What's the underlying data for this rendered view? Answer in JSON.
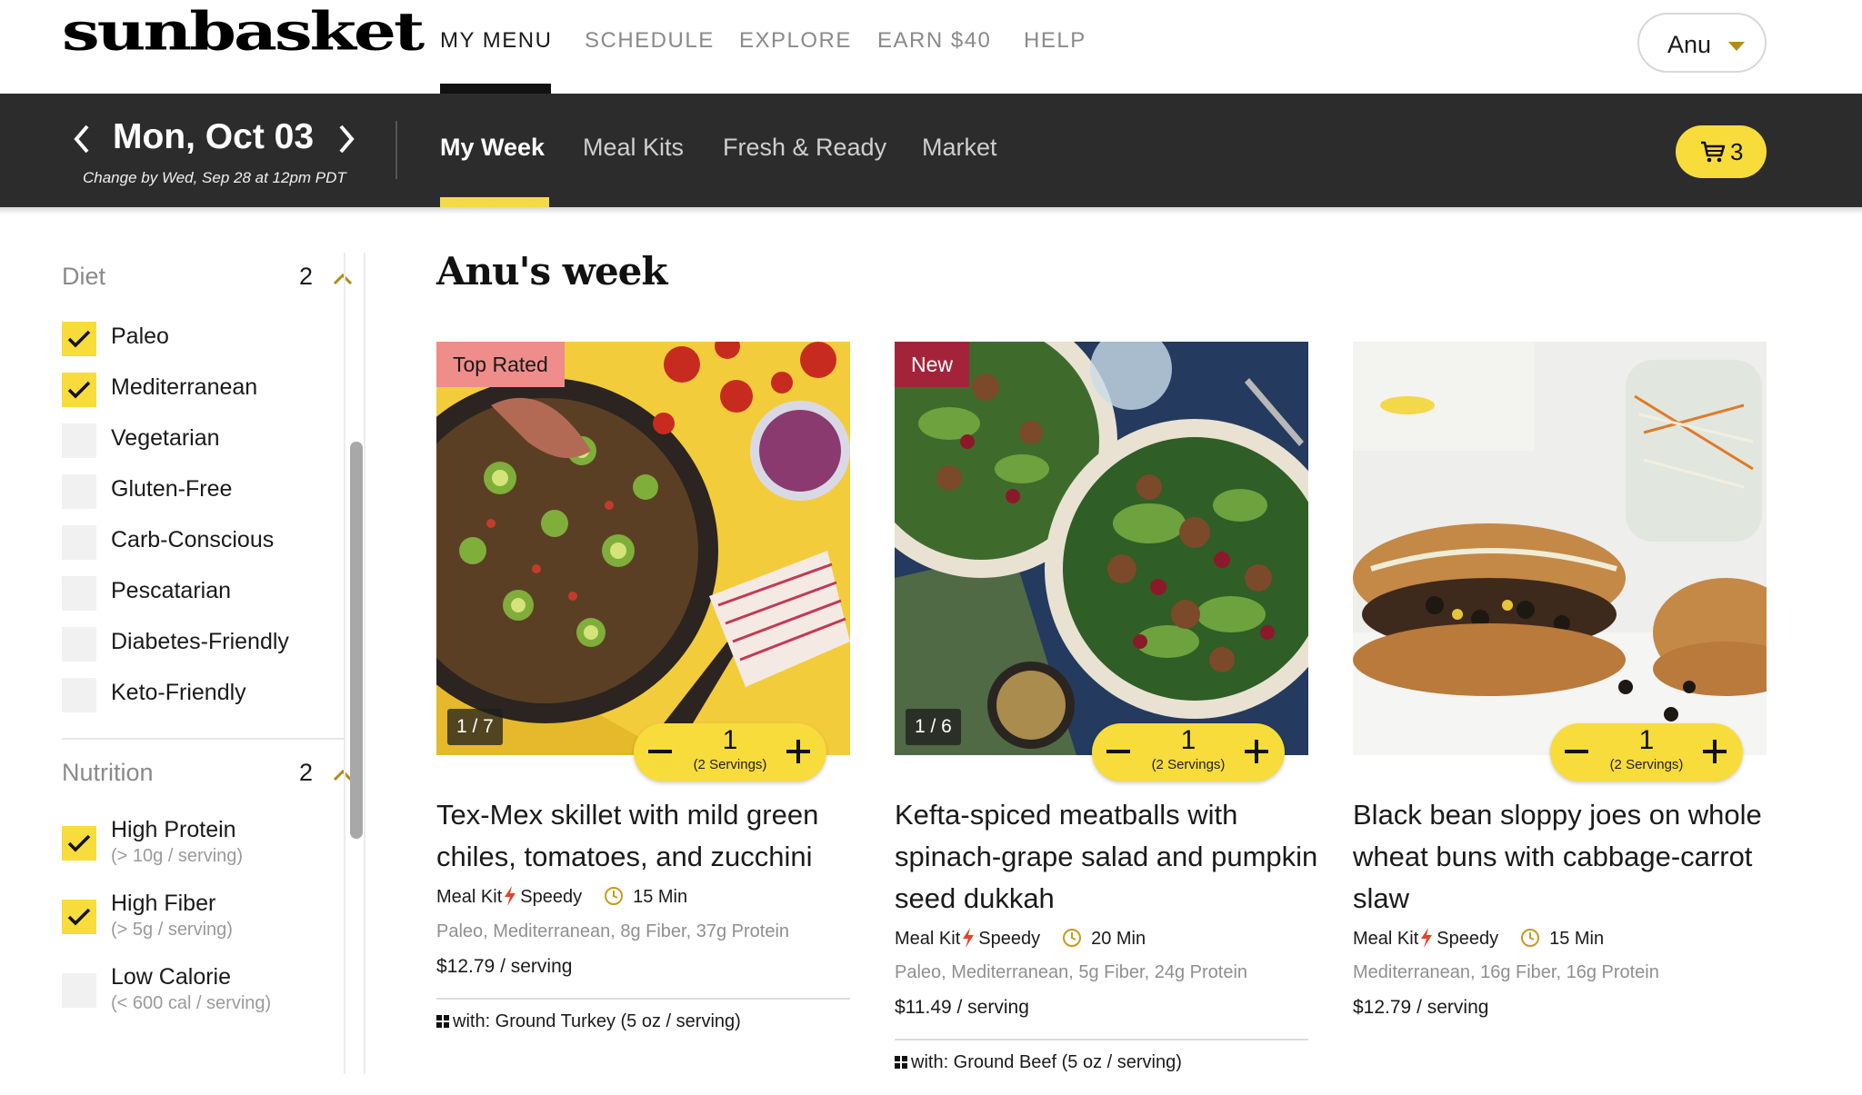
{
  "brand": {
    "logo_text": "sunbasket"
  },
  "topnav": {
    "links": [
      "MY MENU",
      "SCHEDULE",
      "EXPLORE",
      "EARN $40",
      "HELP"
    ],
    "user_name": "Anu"
  },
  "weekbar": {
    "date": "Mon, Oct 03",
    "change_note": "Change by Wed, Sep 28 at 12pm PDT",
    "tabs": [
      "My Week",
      "Meal Kits",
      "Fresh & Ready",
      "Market"
    ],
    "cart_count": "3"
  },
  "sidebar": {
    "diet": {
      "title": "Diet",
      "count": "2",
      "options": [
        {
          "label": "Paleo",
          "checked": true
        },
        {
          "label": "Mediterranean",
          "checked": true
        },
        {
          "label": "Vegetarian",
          "checked": false
        },
        {
          "label": "Gluten-Free",
          "checked": false
        },
        {
          "label": "Carb-Conscious",
          "checked": false
        },
        {
          "label": "Pescatarian",
          "checked": false
        },
        {
          "label": "Diabetes-Friendly",
          "checked": false
        },
        {
          "label": "Keto-Friendly",
          "checked": false
        }
      ]
    },
    "nutrition": {
      "title": "Nutrition",
      "count": "2",
      "options": [
        {
          "label": "High Protein",
          "sub": "(> 10g / serving)",
          "checked": true
        },
        {
          "label": "High Fiber",
          "sub": "(> 5g / serving)",
          "checked": true
        },
        {
          "label": "Low Calorie",
          "sub": "(< 600 cal / serving)",
          "checked": false
        }
      ]
    }
  },
  "main": {
    "title": "Anu's week",
    "cards": [
      {
        "badge": "Top Rated",
        "pager": "1 / 7",
        "qty": "1",
        "servings": "(2 Servings)",
        "title": "Tex-Mex skillet with mild green chiles, tomatoes, and zucchini",
        "kit": "Meal Kit",
        "speed": "Speedy",
        "time": "15 Min",
        "tags": "Paleo, Mediterranean, 8g Fiber, 37g Protein",
        "price": "$12.79 / serving",
        "protein": "with: Ground Turkey (5 oz / serving)"
      },
      {
        "badge": "New",
        "pager": "1 / 6",
        "qty": "1",
        "servings": "(2 Servings)",
        "title": "Kefta-spiced meatballs with spinach-grape salad and pumpkin seed dukkah",
        "kit": "Meal Kit",
        "speed": "Speedy",
        "time": "20 Min",
        "tags": "Paleo, Mediterranean, 5g Fiber, 24g Protein",
        "price": "$11.49 / serving",
        "protein": "with: Ground Beef (5 oz / serving)"
      },
      {
        "qty": "1",
        "servings": "(2 Servings)",
        "title": "Black bean sloppy joes on whole wheat buns with cabbage-carrot slaw",
        "kit": "Meal Kit",
        "speed": "Speedy",
        "time": "15 Min",
        "tags": "Mediterranean, 16g Fiber, 16g Protein",
        "price": "$12.79 / serving"
      }
    ]
  },
  "colors": {
    "accent_yellow": "#f7dc3b",
    "dark_bar": "#2c2c2c",
    "badge_top_rated": "#ef8d8a",
    "badge_new": "#a3243a",
    "bolt_red": "#e2432a",
    "clock_gold": "#c99a1f"
  }
}
